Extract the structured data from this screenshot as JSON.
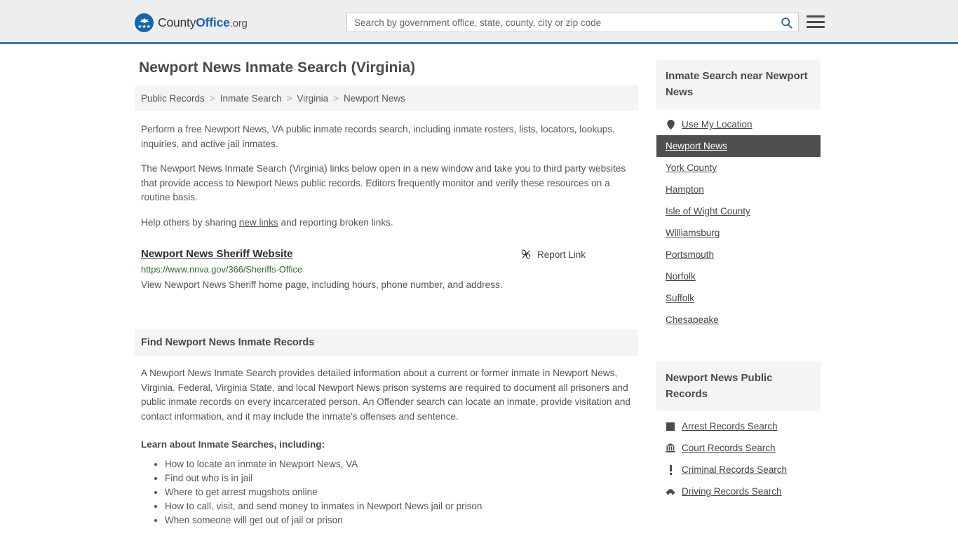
{
  "header": {
    "logo": {
      "name_part1": "County",
      "name_part2": "Office",
      "name_part3": ".org",
      "icon": "eagle-shield-icon",
      "brand_color": "#1765ad"
    },
    "search": {
      "placeholder": "Search by government office, state, county, city or zip code",
      "value": "",
      "search_icon": "search-icon"
    },
    "menu_icon": "hamburger-menu-icon",
    "accent_border_color": "#3b7ba8"
  },
  "main": {
    "title": "Newport News Inmate Search (Virginia)",
    "breadcrumb": {
      "items": [
        "Public Records",
        "Inmate Search",
        "Virginia",
        "Newport News"
      ],
      "separator": ">"
    },
    "intro_paragraph": "Perform a free Newport News, VA public inmate records search, including inmate rosters, lists, locators, lookups, inquiries, and active jail inmates.",
    "second_paragraph": "The Newport News Inmate Search (Virginia) links below open in a new window and take you to third party websites that provide access to Newport News public records. Editors frequently monitor and verify these resources on a routine basis.",
    "share_prefix": "Help others by sharing ",
    "share_link": "new links",
    "share_suffix": " and reporting broken links.",
    "result": {
      "title": "Newport News Sheriff Website",
      "url": "https://www.nnva.gov/366/Sheriffs-Office",
      "description": "View Newport News Sheriff home page, including hours, phone number, and address.",
      "report_label": "Report Link",
      "report_icon": "broken-link-icon"
    },
    "section": {
      "heading": "Find Newport News Inmate Records",
      "paragraph": "A Newport News Inmate Search provides detailed information about a current or former inmate in Newport News, Virginia. Federal, Virginia State, and local Newport News prison systems are required to document all prisoners and public inmate records on every incarcerated person. An Offender search can locate an inmate, provide visitation and contact information, and it may include the inmate's offenses and sentence.",
      "learn_label": "Learn about Inmate Searches, including:",
      "bullets": [
        "How to locate an inmate in Newport News, VA",
        "Find out who is in jail",
        "Where to get arrest mugshots online",
        "How to call, visit, and send money to inmates in Newport News jail or prison",
        "When someone will get out of jail or prison"
      ]
    }
  },
  "sidebar": {
    "nearby": {
      "heading": "Inmate Search near Newport News",
      "items": [
        {
          "label": "Use My Location",
          "icon": "location-pin-icon",
          "active": false
        },
        {
          "label": "Newport News",
          "icon": "",
          "active": true
        },
        {
          "label": "York County",
          "icon": "",
          "active": false
        },
        {
          "label": "Hampton",
          "icon": "",
          "active": false
        },
        {
          "label": "Isle of Wight County",
          "icon": "",
          "active": false
        },
        {
          "label": "Williamsburg",
          "icon": "",
          "active": false
        },
        {
          "label": "Portsmouth",
          "icon": "",
          "active": false
        },
        {
          "label": "Norfolk",
          "icon": "",
          "active": false
        },
        {
          "label": "Suffolk",
          "icon": "",
          "active": false
        },
        {
          "label": "Chesapeake",
          "icon": "",
          "active": false
        }
      ],
      "active_bg_color": "#4f4f4f"
    },
    "public_records": {
      "heading": "Newport News Public Records",
      "items": [
        {
          "label": "Arrest Records Search",
          "icon": "gavel-icon"
        },
        {
          "label": "Court Records Search",
          "icon": "courthouse-icon"
        },
        {
          "label": "Criminal Records Search",
          "icon": "exclamation-icon"
        },
        {
          "label": "Driving Records Search",
          "icon": "car-icon"
        }
      ]
    }
  }
}
